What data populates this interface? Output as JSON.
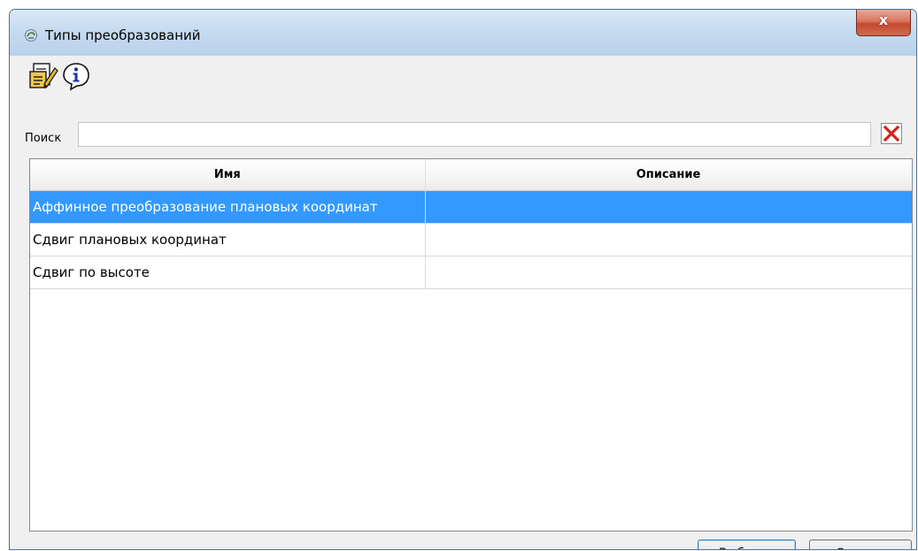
{
  "window": {
    "title": "Типы преобразований",
    "close_label": "x"
  },
  "toolbar": {
    "items": [
      {
        "icon": "edit-document-icon"
      },
      {
        "icon": "info-icon"
      }
    ]
  },
  "search": {
    "label": "Поиск",
    "value": "",
    "placeholder": ""
  },
  "table": {
    "columns": [
      "Имя",
      "Описание"
    ],
    "rows": [
      {
        "name": "Аффинное преобразование плановых координат",
        "description": "",
        "selected": true
      },
      {
        "name": "Сдвиг плановых координат",
        "description": "",
        "selected": false
      },
      {
        "name": "Сдвиг по высоте",
        "description": "",
        "selected": false
      }
    ]
  },
  "buttons": {
    "select": "Выбрать",
    "cancel": "Отмена"
  },
  "colors": {
    "selection": "#3399ff",
    "close_button": "#c24a30",
    "clear_icon": "#d42020"
  }
}
